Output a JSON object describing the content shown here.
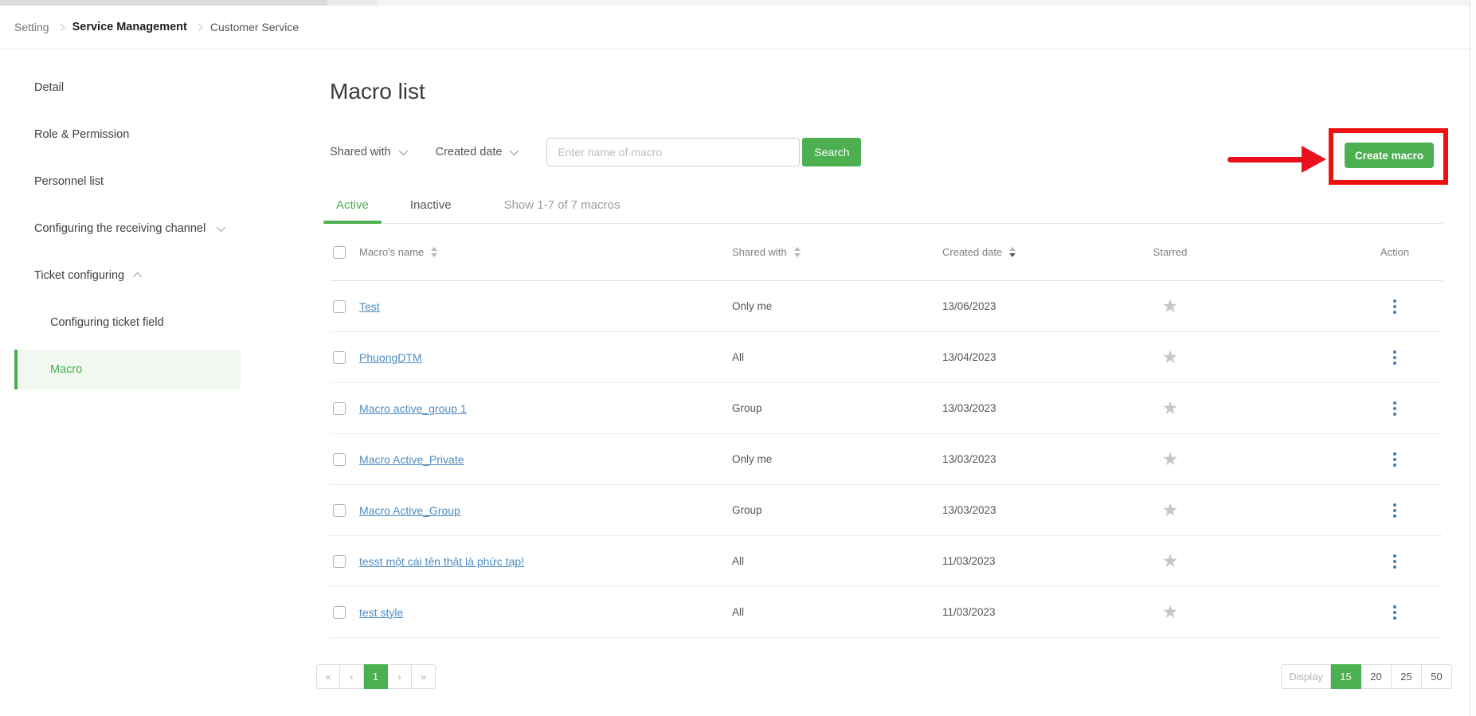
{
  "breadcrumb": {
    "setting": "Setting",
    "service_management": "Service Management",
    "customer_service": "Customer Service"
  },
  "sidebar": {
    "detail": "Detail",
    "role_permission": "Role & Permission",
    "personnel_list": "Personnel list",
    "receiving_channel": "Configuring the receiving channel",
    "ticket_configuring": "Ticket configuring",
    "configuring_ticket_field": "Configuring ticket field",
    "macro": "Macro"
  },
  "main": {
    "title": "Macro list",
    "filters": {
      "shared_with_label": "Shared with",
      "created_date_label": "Created date",
      "search_placeholder": "Enter name of macro",
      "search_button": "Search"
    },
    "create_button": "Create macro",
    "tabs": {
      "active": "Active",
      "inactive": "Inactive",
      "summary": "Show 1-7 of 7 macros"
    },
    "table": {
      "headers": {
        "name": "Macro's name",
        "shared": "Shared with",
        "created": "Created date",
        "starred": "Starred",
        "action": "Action"
      },
      "rows": [
        {
          "name": "Test",
          "shared": "Only me",
          "created": "13/06/2023"
        },
        {
          "name": "PhuongDTM",
          "shared": "All",
          "created": "13/04/2023"
        },
        {
          "name": "Macro active_group 1",
          "shared": "Group",
          "created": "13/03/2023"
        },
        {
          "name": "Macro Active_Private",
          "shared": "Only me",
          "created": "13/03/2023"
        },
        {
          "name": "Macro Active_Group",
          "shared": "Group",
          "created": "13/03/2023"
        },
        {
          "name": "tesst một cái tên thật là phức tạp!",
          "shared": "All",
          "created": "11/03/2023"
        },
        {
          "name": "test style",
          "shared": "All",
          "created": "11/03/2023"
        }
      ]
    },
    "pagination": {
      "first_label": "«",
      "prev_label": "‹",
      "page": "1",
      "next_label": "›",
      "last_label": "»"
    },
    "page_size": {
      "label": "Display",
      "options": [
        "15",
        "20",
        "25",
        "50"
      ],
      "selected": "15"
    }
  },
  "icons": {
    "star": "★"
  },
  "colors": {
    "accent_green": "#4caf50",
    "link_blue": "#4e8cc2",
    "annotation_red": "#ee1111",
    "active_item_bg": "#f0f8ef"
  }
}
